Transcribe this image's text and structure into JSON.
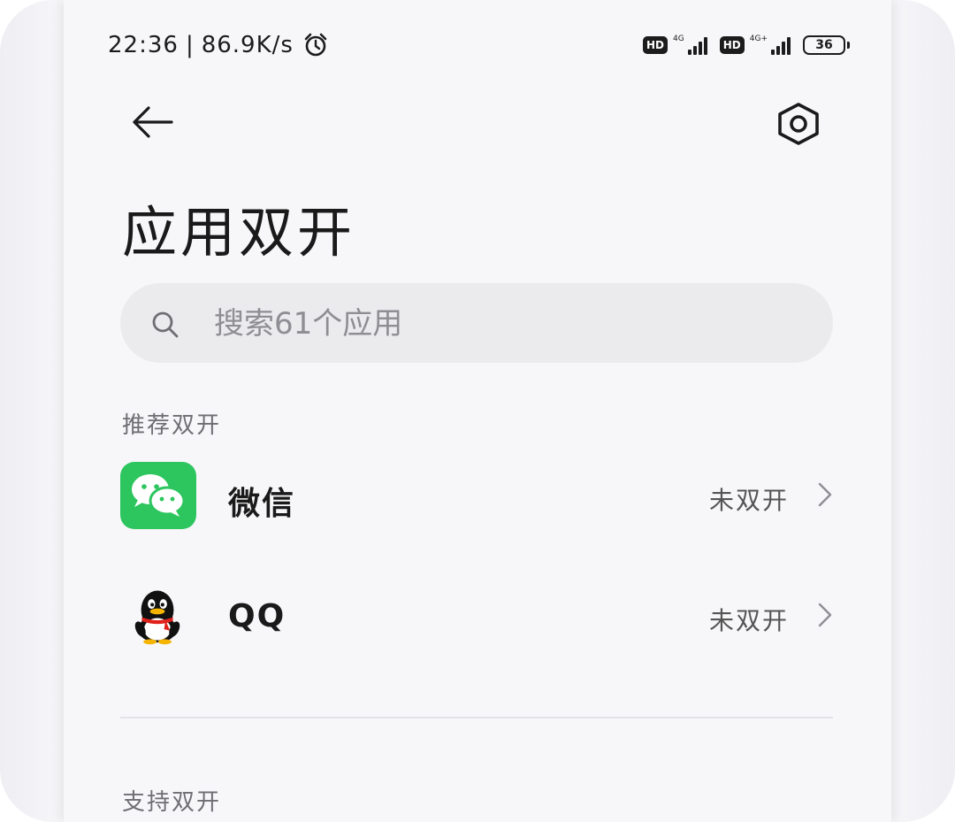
{
  "status_bar": {
    "time": "22:36",
    "separator": "|",
    "net_speed": "86.9K/s",
    "sim1_badge": "HD",
    "sim1_net": "4G",
    "sim2_badge": "HD",
    "sim2_net": "4G+",
    "battery": "36",
    "icons": [
      "alarm-icon",
      "signal-icon",
      "battery-icon"
    ]
  },
  "header": {
    "back_icon": "arrow-left-icon",
    "settings_icon": "gear-icon"
  },
  "page": {
    "title": "应用双开"
  },
  "search": {
    "placeholder": "搜索61个应用",
    "value": ""
  },
  "sections": {
    "recommended": {
      "label": "推荐双开",
      "items": [
        {
          "name": "微信",
          "status": "未双开",
          "icon": "wechat-icon"
        },
        {
          "name": "QQ",
          "status": "未双开",
          "icon": "qq-icon"
        }
      ]
    },
    "supported": {
      "label": "支持双开"
    }
  },
  "colors": {
    "wechat_green": "#2dc55e",
    "background": "#f7f7fa",
    "search_bg": "#ebebee"
  }
}
